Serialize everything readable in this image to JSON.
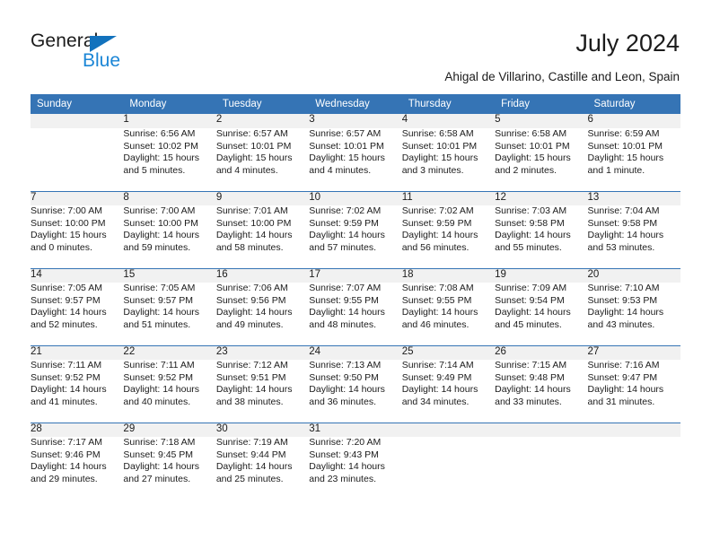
{
  "brand": {
    "name_primary": "General",
    "name_secondary": "Blue",
    "logo_triangle_color": "#1272bd",
    "secondary_color": "#1b86d6"
  },
  "header": {
    "title": "July 2024",
    "subtitle": "Ahigal de Villarino, Castille and Leon, Spain",
    "header_bg_color": "#3574b5",
    "header_text_color": "#ffffff",
    "row_divider_color": "#3574b5",
    "daynum_band_color": "#f1f1f1"
  },
  "weekday_headers": [
    "Sunday",
    "Monday",
    "Tuesday",
    "Wednesday",
    "Thursday",
    "Friday",
    "Saturday"
  ],
  "weeks": [
    [
      {
        "day": "",
        "sunrise": "",
        "sunset": "",
        "daylight_line1": "",
        "daylight_line2": ""
      },
      {
        "day": "1",
        "sunrise": "Sunrise: 6:56 AM",
        "sunset": "Sunset: 10:02 PM",
        "daylight_line1": "Daylight: 15 hours",
        "daylight_line2": "and 5 minutes."
      },
      {
        "day": "2",
        "sunrise": "Sunrise: 6:57 AM",
        "sunset": "Sunset: 10:01 PM",
        "daylight_line1": "Daylight: 15 hours",
        "daylight_line2": "and 4 minutes."
      },
      {
        "day": "3",
        "sunrise": "Sunrise: 6:57 AM",
        "sunset": "Sunset: 10:01 PM",
        "daylight_line1": "Daylight: 15 hours",
        "daylight_line2": "and 4 minutes."
      },
      {
        "day": "4",
        "sunrise": "Sunrise: 6:58 AM",
        "sunset": "Sunset: 10:01 PM",
        "daylight_line1": "Daylight: 15 hours",
        "daylight_line2": "and 3 minutes."
      },
      {
        "day": "5",
        "sunrise": "Sunrise: 6:58 AM",
        "sunset": "Sunset: 10:01 PM",
        "daylight_line1": "Daylight: 15 hours",
        "daylight_line2": "and 2 minutes."
      },
      {
        "day": "6",
        "sunrise": "Sunrise: 6:59 AM",
        "sunset": "Sunset: 10:01 PM",
        "daylight_line1": "Daylight: 15 hours",
        "daylight_line2": "and 1 minute."
      }
    ],
    [
      {
        "day": "7",
        "sunrise": "Sunrise: 7:00 AM",
        "sunset": "Sunset: 10:00 PM",
        "daylight_line1": "Daylight: 15 hours",
        "daylight_line2": "and 0 minutes."
      },
      {
        "day": "8",
        "sunrise": "Sunrise: 7:00 AM",
        "sunset": "Sunset: 10:00 PM",
        "daylight_line1": "Daylight: 14 hours",
        "daylight_line2": "and 59 minutes."
      },
      {
        "day": "9",
        "sunrise": "Sunrise: 7:01 AM",
        "sunset": "Sunset: 10:00 PM",
        "daylight_line1": "Daylight: 14 hours",
        "daylight_line2": "and 58 minutes."
      },
      {
        "day": "10",
        "sunrise": "Sunrise: 7:02 AM",
        "sunset": "Sunset: 9:59 PM",
        "daylight_line1": "Daylight: 14 hours",
        "daylight_line2": "and 57 minutes."
      },
      {
        "day": "11",
        "sunrise": "Sunrise: 7:02 AM",
        "sunset": "Sunset: 9:59 PM",
        "daylight_line1": "Daylight: 14 hours",
        "daylight_line2": "and 56 minutes."
      },
      {
        "day": "12",
        "sunrise": "Sunrise: 7:03 AM",
        "sunset": "Sunset: 9:58 PM",
        "daylight_line1": "Daylight: 14 hours",
        "daylight_line2": "and 55 minutes."
      },
      {
        "day": "13",
        "sunrise": "Sunrise: 7:04 AM",
        "sunset": "Sunset: 9:58 PM",
        "daylight_line1": "Daylight: 14 hours",
        "daylight_line2": "and 53 minutes."
      }
    ],
    [
      {
        "day": "14",
        "sunrise": "Sunrise: 7:05 AM",
        "sunset": "Sunset: 9:57 PM",
        "daylight_line1": "Daylight: 14 hours",
        "daylight_line2": "and 52 minutes."
      },
      {
        "day": "15",
        "sunrise": "Sunrise: 7:05 AM",
        "sunset": "Sunset: 9:57 PM",
        "daylight_line1": "Daylight: 14 hours",
        "daylight_line2": "and 51 minutes."
      },
      {
        "day": "16",
        "sunrise": "Sunrise: 7:06 AM",
        "sunset": "Sunset: 9:56 PM",
        "daylight_line1": "Daylight: 14 hours",
        "daylight_line2": "and 49 minutes."
      },
      {
        "day": "17",
        "sunrise": "Sunrise: 7:07 AM",
        "sunset": "Sunset: 9:55 PM",
        "daylight_line1": "Daylight: 14 hours",
        "daylight_line2": "and 48 minutes."
      },
      {
        "day": "18",
        "sunrise": "Sunrise: 7:08 AM",
        "sunset": "Sunset: 9:55 PM",
        "daylight_line1": "Daylight: 14 hours",
        "daylight_line2": "and 46 minutes."
      },
      {
        "day": "19",
        "sunrise": "Sunrise: 7:09 AM",
        "sunset": "Sunset: 9:54 PM",
        "daylight_line1": "Daylight: 14 hours",
        "daylight_line2": "and 45 minutes."
      },
      {
        "day": "20",
        "sunrise": "Sunrise: 7:10 AM",
        "sunset": "Sunset: 9:53 PM",
        "daylight_line1": "Daylight: 14 hours",
        "daylight_line2": "and 43 minutes."
      }
    ],
    [
      {
        "day": "21",
        "sunrise": "Sunrise: 7:11 AM",
        "sunset": "Sunset: 9:52 PM",
        "daylight_line1": "Daylight: 14 hours",
        "daylight_line2": "and 41 minutes."
      },
      {
        "day": "22",
        "sunrise": "Sunrise: 7:11 AM",
        "sunset": "Sunset: 9:52 PM",
        "daylight_line1": "Daylight: 14 hours",
        "daylight_line2": "and 40 minutes."
      },
      {
        "day": "23",
        "sunrise": "Sunrise: 7:12 AM",
        "sunset": "Sunset: 9:51 PM",
        "daylight_line1": "Daylight: 14 hours",
        "daylight_line2": "and 38 minutes."
      },
      {
        "day": "24",
        "sunrise": "Sunrise: 7:13 AM",
        "sunset": "Sunset: 9:50 PM",
        "daylight_line1": "Daylight: 14 hours",
        "daylight_line2": "and 36 minutes."
      },
      {
        "day": "25",
        "sunrise": "Sunrise: 7:14 AM",
        "sunset": "Sunset: 9:49 PM",
        "daylight_line1": "Daylight: 14 hours",
        "daylight_line2": "and 34 minutes."
      },
      {
        "day": "26",
        "sunrise": "Sunrise: 7:15 AM",
        "sunset": "Sunset: 9:48 PM",
        "daylight_line1": "Daylight: 14 hours",
        "daylight_line2": "and 33 minutes."
      },
      {
        "day": "27",
        "sunrise": "Sunrise: 7:16 AM",
        "sunset": "Sunset: 9:47 PM",
        "daylight_line1": "Daylight: 14 hours",
        "daylight_line2": "and 31 minutes."
      }
    ],
    [
      {
        "day": "28",
        "sunrise": "Sunrise: 7:17 AM",
        "sunset": "Sunset: 9:46 PM",
        "daylight_line1": "Daylight: 14 hours",
        "daylight_line2": "and 29 minutes."
      },
      {
        "day": "29",
        "sunrise": "Sunrise: 7:18 AM",
        "sunset": "Sunset: 9:45 PM",
        "daylight_line1": "Daylight: 14 hours",
        "daylight_line2": "and 27 minutes."
      },
      {
        "day": "30",
        "sunrise": "Sunrise: 7:19 AM",
        "sunset": "Sunset: 9:44 PM",
        "daylight_line1": "Daylight: 14 hours",
        "daylight_line2": "and 25 minutes."
      },
      {
        "day": "31",
        "sunrise": "Sunrise: 7:20 AM",
        "sunset": "Sunset: 9:43 PM",
        "daylight_line1": "Daylight: 14 hours",
        "daylight_line2": "and 23 minutes."
      },
      {
        "day": "",
        "sunrise": "",
        "sunset": "",
        "daylight_line1": "",
        "daylight_line2": ""
      },
      {
        "day": "",
        "sunrise": "",
        "sunset": "",
        "daylight_line1": "",
        "daylight_line2": ""
      },
      {
        "day": "",
        "sunrise": "",
        "sunset": "",
        "daylight_line1": "",
        "daylight_line2": ""
      }
    ]
  ]
}
